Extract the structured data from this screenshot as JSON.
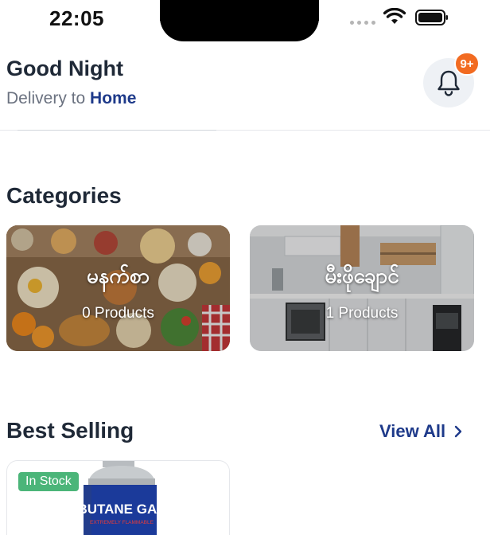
{
  "status_bar": {
    "time": "22:05",
    "icons": [
      "signal-dots-icon",
      "wifi-icon",
      "battery-icon"
    ]
  },
  "header": {
    "greeting": "Good Night",
    "delivery_prefix": "Delivery to",
    "delivery_location": "Home",
    "notification_badge": "9+",
    "notification_icon": "bell-icon"
  },
  "categories": {
    "title": "Categories",
    "items": [
      {
        "name": "မနက်စာ",
        "count": "0 Products"
      },
      {
        "name": "မီးဖိုချောင်",
        "count": "1 Products"
      }
    ]
  },
  "best_selling": {
    "title": "Best Selling",
    "view_all": "View All",
    "products": [
      {
        "stock_status": "In Stock",
        "image_text": "BUTANE GAS",
        "image_subtext": "EXTREMELY FLAMMABLE"
      }
    ]
  },
  "colors": {
    "accent_blue": "#1e3a8a",
    "badge_orange": "#f26b21",
    "stock_green": "#4bb579"
  }
}
